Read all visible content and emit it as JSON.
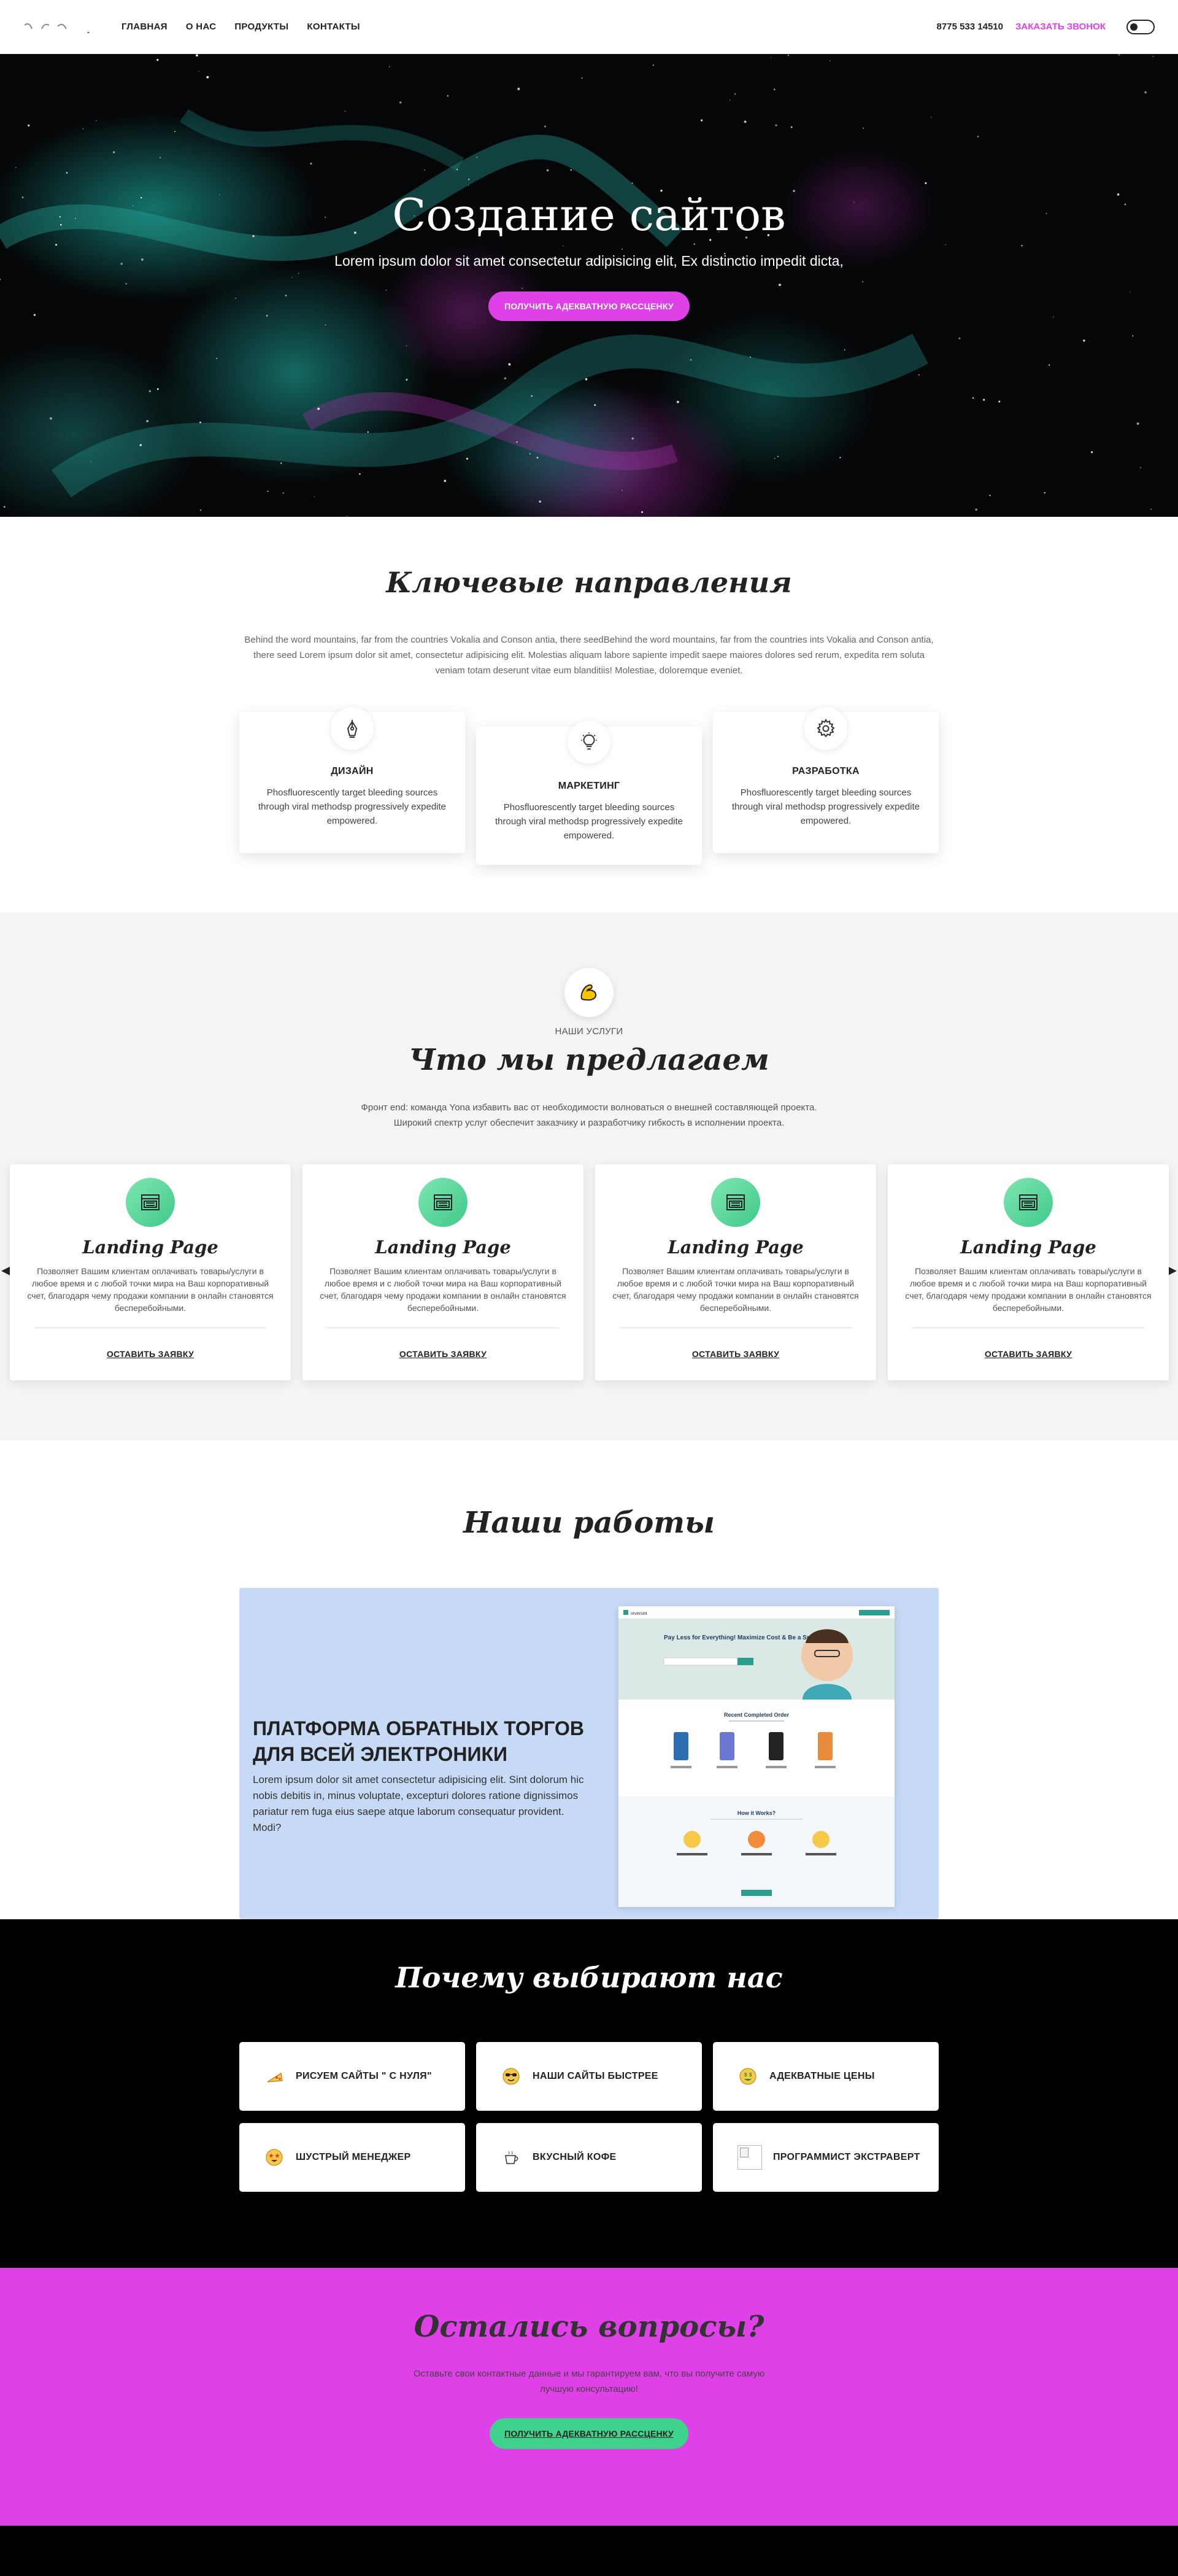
{
  "header": {
    "nav": [
      "ГЛАВНАЯ",
      "О НАС",
      "ПРОДУКТЫ",
      "КОНТАКТЫ"
    ],
    "phone": "8775 533 14510",
    "callback": "ЗАКАЗАТЬ ЗВОНОК"
  },
  "hero": {
    "title": "Создание сайтов",
    "subtitle": "Lorem ipsum dolor sit amet consectetur adipisicing elit, Ex distinctio impedit dicta,",
    "button": "ПОЛУЧИТЬ АДЕКВАТНУЮ РАССЦЕНКУ"
  },
  "directions": {
    "title": "Ключевые направления",
    "text": "Behind the word mountains, far from the countries Vokalia and Conson antia, there seedBehind the word mountains, far from the countries ints Vokalia and Conson antia, there seed Lorem ipsum dolor sit amet, consectetur adipisicing elit. Molestias aliquam labore sapiente impedit saepe maiores dolores sed rerum, expedita rem soluta veniam totam deserunt vitae eum blanditiis! Molestiae, doloremque eveniet.",
    "cards": [
      {
        "icon": "pen-tool-icon",
        "title": "ДИЗАЙН",
        "text": "Phosfluorescently target bleeding sources through viral methodsp progressively expedite empowered."
      },
      {
        "icon": "lightbulb-icon",
        "title": "МАРКЕТИНГ",
        "text": "Phosfluorescently target bleeding sources through viral methodsp progressively expedite empowered."
      },
      {
        "icon": "gear-icon",
        "title": "РАЗРАБОТКА",
        "text": "Phosfluorescently target bleeding sources through viral methodsp progressively expedite empowered."
      }
    ]
  },
  "services": {
    "label": "НАШИ УСЛУГИ",
    "title": "Что мы предлагаем",
    "desc": "Фронт end: команда Yona избавить вас от необходимости волноваться о внешней составляющей проекта. Широкий спектр услуг обеспечит заказчику и разработчику гибкость в исполнении проекта.",
    "cards": [
      {
        "title": "Landing Page",
        "text": "Позволяет Вашим клиентам оплачивать товары/услуги в любое время и с любой точки мира на Ваш корпоративный счет, благодаря чему продажи компании в онлайн становятся бесперебойными.",
        "link": "ОСТАВИТЬ ЗАЯВКУ"
      },
      {
        "title": "Landing Page",
        "text": "Позволяет Вашим клиентам оплачивать товары/услуги в любое время и с любой точки мира на Ваш корпоративный счет, благодаря чему продажи компании в онлайн становятся бесперебойными.",
        "link": "ОСТАВИТЬ ЗАЯВКУ"
      },
      {
        "title": "Landing Page",
        "text": "Позволяет Вашим клиентам оплачивать товары/услуги в любое время и с любой точки мира на Ваш корпоративный счет, благодаря чему продажи компании в онлайн становятся бесперебойными.",
        "link": "ОСТАВИТЬ ЗАЯВКУ"
      },
      {
        "title": "Landing Page",
        "text": "Позволяет Вашим клиентам оплачивать товары/услуги в любое время и с любой точки мира на Ваш корпоративный счет, благодаря чему продажи компании в онлайн становятся бесперебойными.",
        "link": "ОСТАВИТЬ ЗАЯВКУ"
      }
    ]
  },
  "works": {
    "title": "Наши работы",
    "project_title": "ПЛАТФОРМА ОБРАТНЫХ ТОРГОВ ДЛЯ ВСЕЙ ЭЛЕКТРОНИКИ",
    "project_text": "Lorem ipsum dolor sit amet consectetur adipisicing elit. Sint dolorum hic nobis debitis in, minus voluptate, excepturi dolores ratione dignissimos pariatur rem fuga eius saepe atque laborum consequatur provident. Modi?",
    "mock": {
      "brand": "reverseit",
      "headline": "Pay Less for Everything! Maximize Cost & Be a Smart Buyer",
      "section1": "Recent Completed Order",
      "section2": "How it Works?"
    }
  },
  "why": {
    "title": "Почему выбирают нас",
    "items": [
      {
        "icon": "pizza-icon",
        "label": "РИСУЕМ САЙТЫ \" С НУЛЯ\""
      },
      {
        "icon": "sunglasses-face-icon",
        "label": "НАШИ САЙТЫ БЫСТРЕЕ"
      },
      {
        "icon": "money-face-icon",
        "label": "АДЕКВАТНЫЕ ЦЕНЫ"
      },
      {
        "icon": "star-eyes-face-icon",
        "label": "ШУСТРЫЙ МЕНЕДЖЕР"
      },
      {
        "icon": "coffee-cup-icon",
        "label": "ВКУСНЫЙ КОФЕ"
      },
      {
        "icon": "broken-image-icon",
        "label": "ПРОГРАММИСТ ЭКСТРАВЕРТ"
      }
    ]
  },
  "questions": {
    "title": "Остались вопросы?",
    "text": "Оставьте свои контактные данные и мы гарантируем вам, что вы получите самую лучшую консультацию!",
    "button": "ПОЛУЧИТЬ АДЕКВАТНУЮ РАССЦЕНКУ"
  },
  "colors": {
    "accent_pink": "#e040e8",
    "accent_green": "#3ed28c",
    "works_bg": "#c6daf6"
  }
}
